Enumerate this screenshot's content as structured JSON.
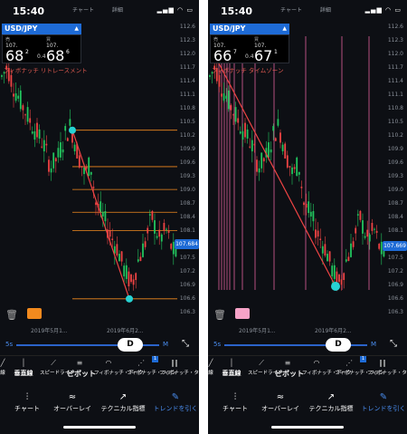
{
  "status": {
    "time": "15:40",
    "tab_chart": "チャート",
    "tab_detail": "詳細",
    "icons": "signal wifi battery"
  },
  "pair": {
    "symbol": "USD/JPY",
    "chevron": "▲"
  },
  "quotes": {
    "left": {
      "sell_label": "売",
      "buy_label": "買",
      "sell_prefix": "107.",
      "sell_big": "68",
      "sell_sup": "2",
      "buy_prefix": "107.",
      "buy_big": "68",
      "buy_sup": "6",
      "spread": "0.4"
    },
    "right": {
      "sell_label": "売",
      "buy_label": "買",
      "sell_prefix": "107.",
      "sell_big": "66",
      "sell_sup": "7",
      "buy_prefix": "107.",
      "buy_big": "67",
      "buy_sup": "1",
      "spread": "0.4"
    }
  },
  "overlay_labels": {
    "left": "フィボナッチ リトレースメント",
    "right": "フィボナッチ タイムゾーン"
  },
  "y_ticks": [
    "112.6",
    "112.3",
    "112.0",
    "111.7",
    "111.4",
    "111.1",
    "110.8",
    "110.5",
    "110.2",
    "109.9",
    "109.6",
    "109.3",
    "109.0",
    "108.7",
    "108.4",
    "108.1",
    "107.8",
    "107.5",
    "107.2",
    "106.9",
    "106.6",
    "106.3"
  ],
  "price_tags": {
    "left": "107.684",
    "right": "107.669"
  },
  "x_ticks": [
    "2019年5月1...",
    "2019年6月2..."
  ],
  "swatch_colors": {
    "left": "#f28a1e",
    "right": "#f7a3c8"
  },
  "slider": {
    "min": "5s",
    "max": "M",
    "current": "D"
  },
  "tools": [
    {
      "icon": "line-icon",
      "label": "線"
    },
    {
      "icon": "vertical-line-icon",
      "label": "垂直線"
    },
    {
      "icon": "speed-line-icon",
      "label": "スピードライン"
    },
    {
      "icon": "pivot-icon",
      "label": "ピボット"
    },
    {
      "icon": "fibonacci-arc-icon",
      "label": "フィボナッチ・アーク"
    },
    {
      "icon": "fibonacci-fan-icon",
      "label": "フィボナッチ・ファン"
    },
    {
      "icon": "fibonacci-time-icon",
      "label": "フィボナッチ・タイ"
    }
  ],
  "tool_badge": "1",
  "nav": [
    {
      "icon": "candlestick-icon",
      "label": "チャート"
    },
    {
      "icon": "wave-icon",
      "label": "オーバーレイ"
    },
    {
      "icon": "trend-chart-icon",
      "label": "テクニカル指標"
    },
    {
      "icon": "pencil-icon",
      "label": "トレンドを引く"
    }
  ],
  "colors": {
    "up": "#22c55e",
    "down": "#ef4444",
    "accent": "#1e6bd6",
    "fib_line": "#f28a1e",
    "time_zone": "#e0609a",
    "anchor": "#27d3d3"
  },
  "chart_data": [
    {
      "type": "candlestick",
      "series": "USD/JPY daily",
      "ylim": [
        106.2,
        112.8
      ],
      "x_ticks": [
        "2019年5月1...",
        "2019年6月2..."
      ],
      "last_price": 107.684,
      "overlay": "fibonacci retracement",
      "fib_levels": [
        110.5,
        109.7,
        109.2,
        108.7,
        108.3,
        106.8
      ],
      "anchors": [
        [
          110.5
        ],
        [
          106.8
        ]
      ]
    },
    {
      "type": "candlestick",
      "series": "USD/JPY daily",
      "ylim": [
        106.2,
        112.8
      ],
      "x_ticks": [
        "2019年5月1...",
        "2019年6月2..."
      ],
      "last_price": 107.669,
      "overlay": "fibonacci time zone"
    }
  ]
}
